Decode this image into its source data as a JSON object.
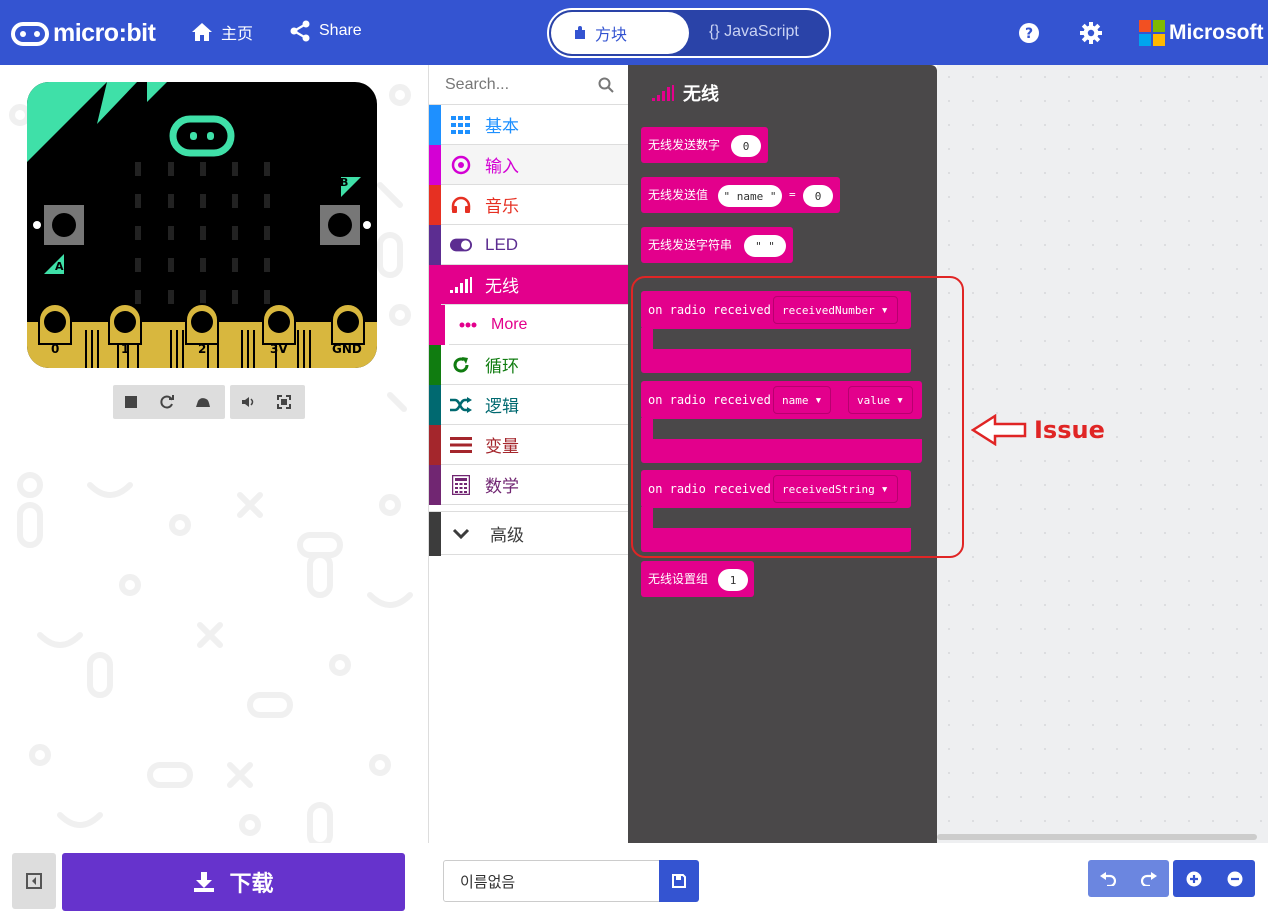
{
  "header": {
    "logo_text": "micro:bit",
    "home_label": "主页",
    "share_label": "Share",
    "blocks_label": "方块",
    "javascript_label": "{} JavaScript",
    "microsoft_label": "Microsoft"
  },
  "simulator": {
    "pins": [
      "0",
      "1",
      "2",
      "3V",
      "GND"
    ],
    "button_a": "A",
    "button_b": "B"
  },
  "toolbox": {
    "search_placeholder": "Search...",
    "categories": [
      {
        "label": "基本",
        "icon": "grid-icon",
        "color": "#1e90ff"
      },
      {
        "label": "输入",
        "icon": "target-icon",
        "color": "#d400d4"
      },
      {
        "label": "音乐",
        "icon": "headphones-icon",
        "color": "#e63022"
      },
      {
        "label": "LED",
        "icon": "toggle-icon",
        "color": "#5c2d91"
      },
      {
        "label": "无线",
        "icon": "signal-bars-icon",
        "color": "#e3008c",
        "selected": true
      },
      {
        "label": "More",
        "icon": "ellipsis-icon",
        "color": "#e3008c"
      },
      {
        "label": "循环",
        "icon": "loop-arrow-icon",
        "color": "#107c10"
      },
      {
        "label": "逻辑",
        "icon": "shuffle-icon",
        "color": "#006970"
      },
      {
        "label": "变量",
        "icon": "list-lines-icon",
        "color": "#a4262c"
      },
      {
        "label": "数学",
        "icon": "calculator-icon",
        "color": "#712672"
      }
    ],
    "advanced_label": "高级"
  },
  "flyout": {
    "title": "无线",
    "blocks": {
      "send_number": {
        "label": "无线发送数字",
        "value": "0"
      },
      "send_value": {
        "label": "无线发送值",
        "name": "\" name \"",
        "equals": "=",
        "value": "0"
      },
      "send_string": {
        "label": "无线发送字符串",
        "value": "\" \""
      },
      "on_received_number": {
        "label": "on radio received",
        "param": "receivedNumber"
      },
      "on_received_value": {
        "label": "on radio received",
        "param1": "name",
        "param2": "value"
      },
      "on_received_string": {
        "label": "on radio received",
        "param": "receivedString"
      },
      "set_group": {
        "label": "无线设置组",
        "value": "1"
      }
    }
  },
  "annotation": {
    "text": "Issue",
    "color": "#e02525"
  },
  "bottom": {
    "download_label": "下载",
    "project_name": "이름없음"
  },
  "colors": {
    "header": "#3454d1",
    "radio": "#e3008c",
    "flyout_bg": "#4a4849",
    "download": "#6633cc"
  }
}
